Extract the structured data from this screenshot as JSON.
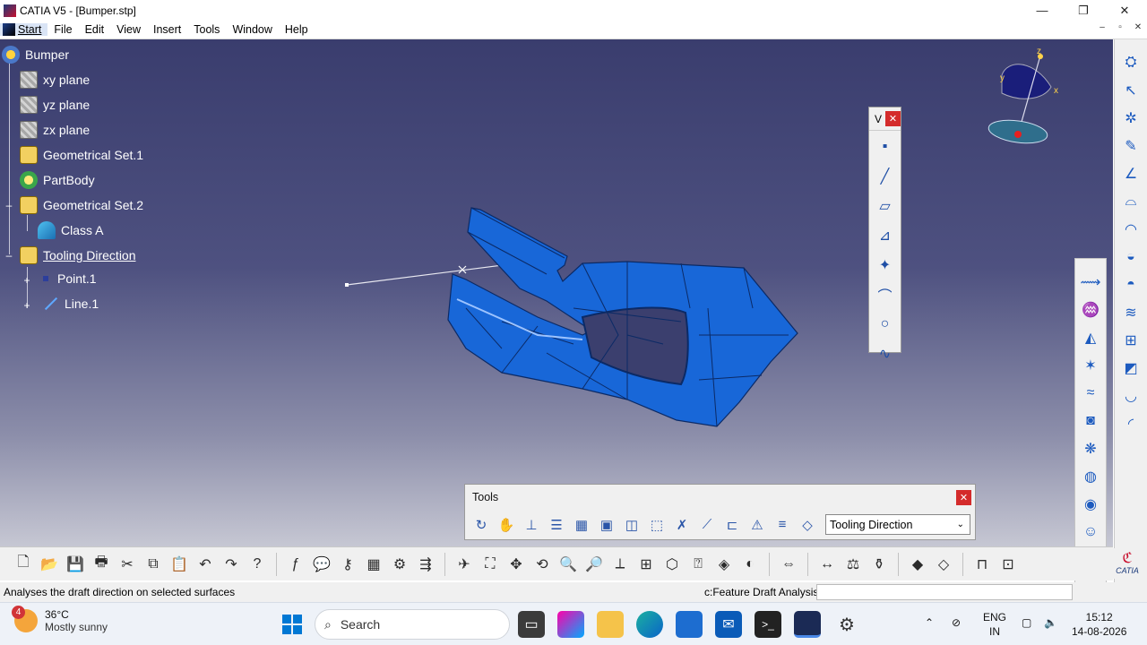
{
  "window": {
    "title": "CATIA V5 - [Bumper.stp]",
    "min": "—",
    "max": "❐",
    "close": "✕"
  },
  "mdi": {
    "min": "–",
    "restore": "▫",
    "close": "✕"
  },
  "menu": {
    "items": [
      "Start",
      "File",
      "Edit",
      "View",
      "Insert",
      "Tools",
      "Window",
      "Help"
    ]
  },
  "tree": {
    "root": "Bumper",
    "nodes": [
      "xy plane",
      "yz plane",
      "zx plane",
      "Geometrical Set.1",
      "PartBody",
      "Geometrical Set.2",
      "Class A",
      "Tooling Direction",
      "Point.1",
      "Line.1"
    ]
  },
  "compass": {
    "z": "z",
    "y": "y",
    "x": "x"
  },
  "float_toolbar": {
    "title": "V",
    "close": "✕"
  },
  "tools_toolbar": {
    "title": "Tools",
    "close": "✕",
    "selected": "Tooling Direction"
  },
  "status": {
    "message": "Analyses the draft direction on selected surfaces",
    "command": "c:Feature Draft Analysis"
  },
  "taskbar": {
    "weather_temp": "36°C",
    "weather_desc": "Mostly sunny",
    "weather_badge": "4",
    "search_placeholder": "Search",
    "lang1": "ENG",
    "lang2": "IN",
    "time": "15:12",
    "date": "14-08-2026"
  },
  "brand": "CATIA"
}
